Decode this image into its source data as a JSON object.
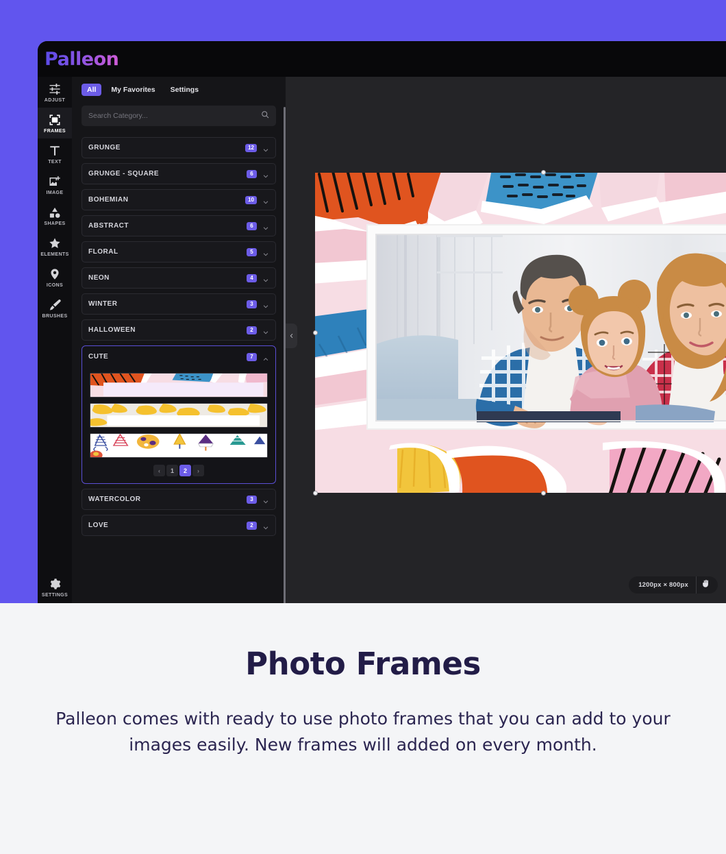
{
  "app": {
    "logo": "Palleon",
    "rail": [
      {
        "label": "ADJUST",
        "icon": "sliders-icon",
        "active": false
      },
      {
        "label": "FRAMES",
        "icon": "frame-icon",
        "active": true
      },
      {
        "label": "TEXT",
        "icon": "text-icon",
        "active": false
      },
      {
        "label": "IMAGE",
        "icon": "image-add-icon",
        "active": false
      },
      {
        "label": "SHAPES",
        "icon": "shapes-icon",
        "active": false
      },
      {
        "label": "ELEMENTS",
        "icon": "star-icon",
        "active": false
      },
      {
        "label": "ICONS",
        "icon": "pin-icon",
        "active": false
      },
      {
        "label": "BRUSHES",
        "icon": "brush-icon",
        "active": false
      }
    ],
    "rail_bottom": {
      "label": "SETTINGS",
      "icon": "gear-icon"
    }
  },
  "panel": {
    "tabs": [
      {
        "label": "All",
        "active": true
      },
      {
        "label": "My Favorites",
        "active": false
      },
      {
        "label": "Settings",
        "active": false
      }
    ],
    "search": {
      "placeholder": "Search Category...",
      "value": "",
      "icon": "search-icon"
    },
    "categories": [
      {
        "name": "GRUNGE",
        "count": "12",
        "expanded": false
      },
      {
        "name": "GRUNGE - SQUARE",
        "count": "6",
        "expanded": false
      },
      {
        "name": "BOHEMIAN",
        "count": "10",
        "expanded": false
      },
      {
        "name": "ABSTRACT",
        "count": "6",
        "expanded": false
      },
      {
        "name": "FLORAL",
        "count": "5",
        "expanded": false
      },
      {
        "name": "NEON",
        "count": "4",
        "expanded": false
      },
      {
        "name": "WINTER",
        "count": "3",
        "expanded": false
      },
      {
        "name": "HALLOWEEN",
        "count": "2",
        "expanded": false
      }
    ],
    "expanded_category": {
      "name": "CUTE",
      "count": "7",
      "thumbnails": [
        {
          "name": "torn-paper-pastel-frame"
        },
        {
          "name": "yellow-brushstroke-frame"
        },
        {
          "name": "party-hats-frame"
        }
      ],
      "pager": {
        "prev": "‹",
        "pages": [
          "1",
          "2"
        ],
        "current": "2",
        "next": "›"
      }
    },
    "categories_after": [
      {
        "name": "WATERCOLOR",
        "count": "3",
        "expanded": false
      },
      {
        "name": "LOVE",
        "count": "2",
        "expanded": false
      }
    ]
  },
  "canvas": {
    "collapse_icon": "chevron-left-icon",
    "dimensions": "1200px × 800px",
    "pan_icon": "hand-icon"
  },
  "content": {
    "heading": "Photo Frames",
    "paragraph": "Palleon comes with ready to use photo frames that you can add to your images easily. New frames will added on every month."
  },
  "colors": {
    "hero_background": "#6155ee",
    "accent": "#6c5ce7",
    "panel_background": "#151518",
    "canvas_background": "#242427",
    "content_background": "#f4f5f7",
    "heading_text": "#221c47"
  }
}
